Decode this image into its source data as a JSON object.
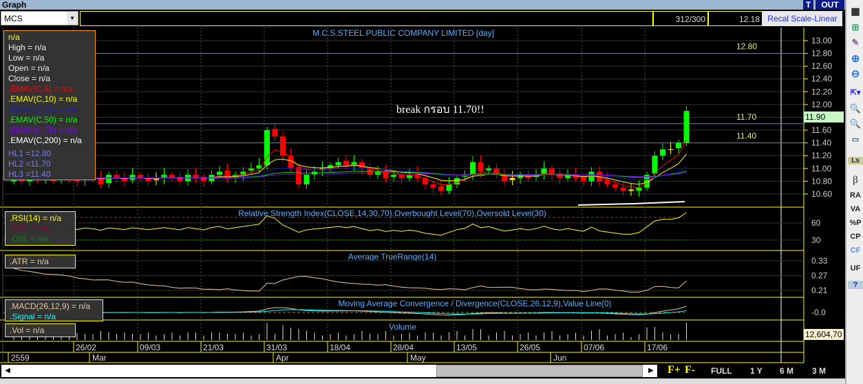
{
  "window": {
    "title": "Graph",
    "t_btn": "T",
    "out_btn": "OUT"
  },
  "toolbar": {
    "symbol": "MCS",
    "count": "312/300",
    "price": "12.18",
    "recal": "Recal Scale-Linear"
  },
  "chart": {
    "title": "M.C.S.STEEL PUBLIC COMPANY LIMITED [day]",
    "annotation": "break กรอบ 11.70!!",
    "current_price_label": "11.90",
    "price_axis": [
      "13.00",
      "12.80",
      "12.60",
      "12.40",
      "12.20",
      "12.00",
      "11.80",
      "11.60",
      "11.40",
      "11.20",
      "11.00",
      "10.80",
      "10.60"
    ],
    "hlines": [
      {
        "value": 12.8,
        "label": "12.80"
      },
      {
        "value": 11.7,
        "label": "11.70"
      },
      {
        "value": 11.4,
        "label": "11.40"
      }
    ],
    "closes": [
      10.85,
      10.8,
      10.9,
      10.85,
      10.95,
      10.8,
      10.9,
      10.85,
      10.8,
      10.9,
      10.85,
      10.75,
      10.9,
      10.85,
      10.8,
      10.9,
      10.85,
      10.8,
      10.85,
      10.9,
      10.85,
      10.8,
      10.9,
      10.85,
      10.8,
      10.9,
      10.95,
      10.85,
      10.9,
      10.95,
      11.0,
      11.05,
      11.6,
      11.5,
      11.2,
      11.0,
      10.75,
      10.9,
      10.95,
      11.0,
      11.05,
      11.1,
      11.05,
      11.1,
      11.0,
      10.9,
      10.95,
      10.85,
      10.9,
      10.85,
      10.9,
      10.85,
      10.75,
      10.7,
      10.65,
      10.75,
      10.85,
      10.9,
      11.1,
      10.95,
      11.0,
      10.9,
      10.8,
      10.85,
      10.9,
      10.85,
      10.9,
      11.0,
      10.9,
      10.85,
      10.9,
      10.85,
      10.8,
      10.95,
      10.8,
      10.75,
      10.7,
      10.65,
      10.65,
      10.7,
      10.9,
      11.2,
      11.3,
      11.3,
      11.4,
      11.9
    ],
    "colors": {
      "up": "#00ff00",
      "down": "#ff0000",
      "hline": "#7070ff",
      "ema5": "#ff0000",
      "ema10": "#ffff00",
      "ema25": "#1010c0",
      "ema50": "#00e000",
      "ema75": "#8000ff",
      "ema200": "#ffffff"
    }
  },
  "legend": {
    "close_label": "n/a",
    "high": "High  = n/a",
    "low": "Low  = n/a",
    "open": "Open  = n/a",
    "close": "Close  = n/a",
    "ema5": ".EMAV(C,5)   = n/a",
    "ema10": ".EMAV(C,10)   = n/a",
    "ema25": ".EMAV(C,25)   = n/a",
    "ema50": ".EMAV(C,50)   = n/a",
    "ema75": ".EMAV(C,75)   = n/a",
    "ema200": ".EMAV(C,200)   = n/a",
    "hl1": "HL1 =12.80",
    "hl2": "HL2 =11.70",
    "hl3": "HL3 =11.40"
  },
  "rsi": {
    "title": "Relative Strength Index(CLOSE,14,30,70),Overbought Level(70),Oversold Level(30)",
    "rsi": ".RSI(14)   = n/a",
    "obl": ".OBL   = n/a",
    "osl": ".OSL   = n/a",
    "axis": [
      "60",
      "30"
    ]
  },
  "atr": {
    "title": "Average TrueRange(14)",
    "atr": ".ATR   = n/a",
    "axis": [
      "0.33",
      "0.27",
      "0.21"
    ]
  },
  "macd": {
    "title": "Moving Average Convergence / Divergence(CLOSE,26,12,9),Value Line(0)",
    "macd": ".MACD(26,12,9)   = n/a",
    "signal": ".Signal   = n/a",
    "axis": [
      "-0.0"
    ]
  },
  "volume": {
    "title": "Volume",
    "vol": ".Vol   = n/a",
    "last": "12,604,70"
  },
  "dates": [
    "26/02",
    "09/03",
    "21/03",
    "31/03",
    "18/04",
    "28/04",
    "13/05",
    "26/05",
    "07/06",
    "17/06"
  ],
  "months": [
    "2559",
    "Mar",
    "Apr",
    "May",
    "Jun"
  ],
  "ranges": [
    "FULL",
    "1 Y",
    "6 M",
    "3 M"
  ],
  "fplus": "F+",
  "fminus": "F-",
  "rightbar": [
    "β",
    "RA",
    "VA",
    "%P",
    "CP",
    "CF",
    "UF",
    "?"
  ]
}
